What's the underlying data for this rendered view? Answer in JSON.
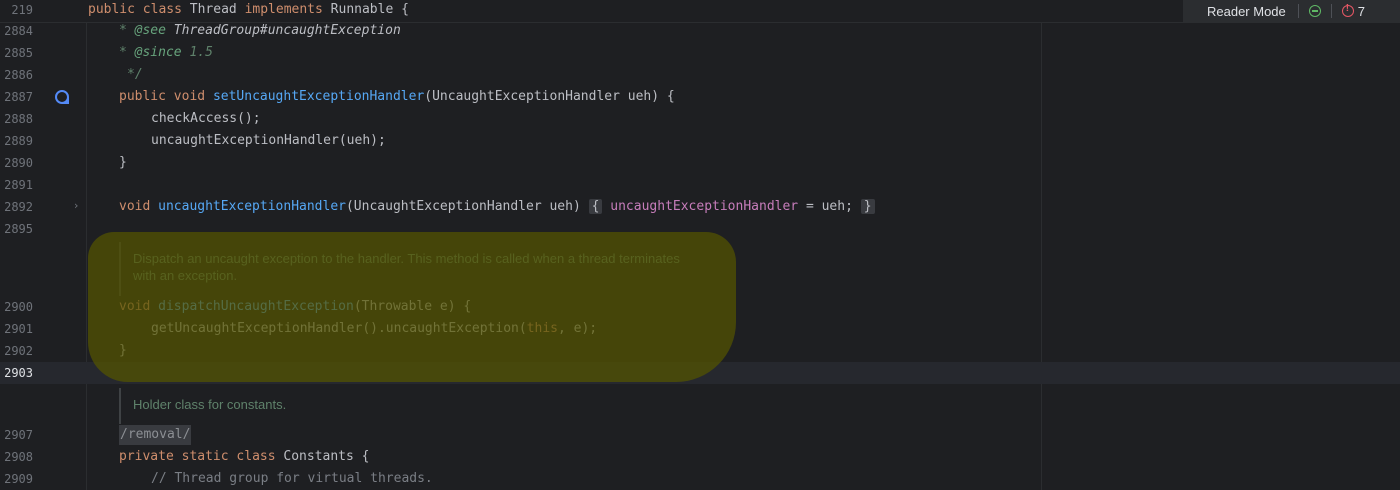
{
  "sticky": {
    "line": "219",
    "kw1": "public",
    "kw2": "class",
    "name": "Thread",
    "kw3": "implements",
    "iface": "Runnable",
    "brace": "{"
  },
  "toolbar": {
    "reader_mode": "Reader Mode",
    "error_count": "7"
  },
  "lines": {
    "l2884": {
      "num": "2884",
      "star": "* ",
      "tag": "@see",
      "ref": "ThreadGroup#",
      "ref2": "uncaughtException"
    },
    "l2885": {
      "num": "2885",
      "star": "* ",
      "tag": "@since",
      "val": " 1.5"
    },
    "l2886": {
      "num": "2886",
      "text": "*/"
    },
    "l2887": {
      "num": "2887",
      "kw1": "public",
      "kw2": "void",
      "fn": "setUncaughtExceptionHandler",
      "rest": "(UncaughtExceptionHandler ueh) {"
    },
    "l2888": {
      "num": "2888",
      "text": "checkAccess();"
    },
    "l2889": {
      "num": "2889",
      "text": "uncaughtExceptionHandler(ueh);"
    },
    "l2890": {
      "num": "2890",
      "text": "}"
    },
    "l2891": {
      "num": "2891"
    },
    "l2892": {
      "num": "2892",
      "kw": "void",
      "fn": "uncaughtExceptionHandler",
      "params": "(UncaughtExceptionHandler ueh)",
      "open": "{",
      "field": "uncaughtExceptionHandler",
      "assign": " = ueh;",
      "close": "}"
    },
    "l2895": {
      "num": "2895"
    },
    "doc1": "Dispatch an uncaught exception to the handler. This method is called when a thread terminates\nwith an exception.",
    "l2900": {
      "num": "2900",
      "kw": "void",
      "fn": "dispatchUncaughtException",
      "rest": "(Throwable e) {"
    },
    "l2901": {
      "num": "2901",
      "pre": "getUncaughtExceptionHandler().uncaughtException(",
      "kw": "this",
      "post": ", e);"
    },
    "l2902": {
      "num": "2902",
      "text": "}"
    },
    "l2903": {
      "num": "2903"
    },
    "doc2": "Holder class for constants.",
    "l2907": {
      "num": "2907",
      "text": "/removal/"
    },
    "l2908": {
      "num": "2908",
      "kw1": "private",
      "kw2": "static",
      "kw3": "class",
      "name": "Constants",
      "brace": " {"
    },
    "l2909": {
      "num": "2909",
      "text": "// Thread group for virtual threads."
    }
  }
}
